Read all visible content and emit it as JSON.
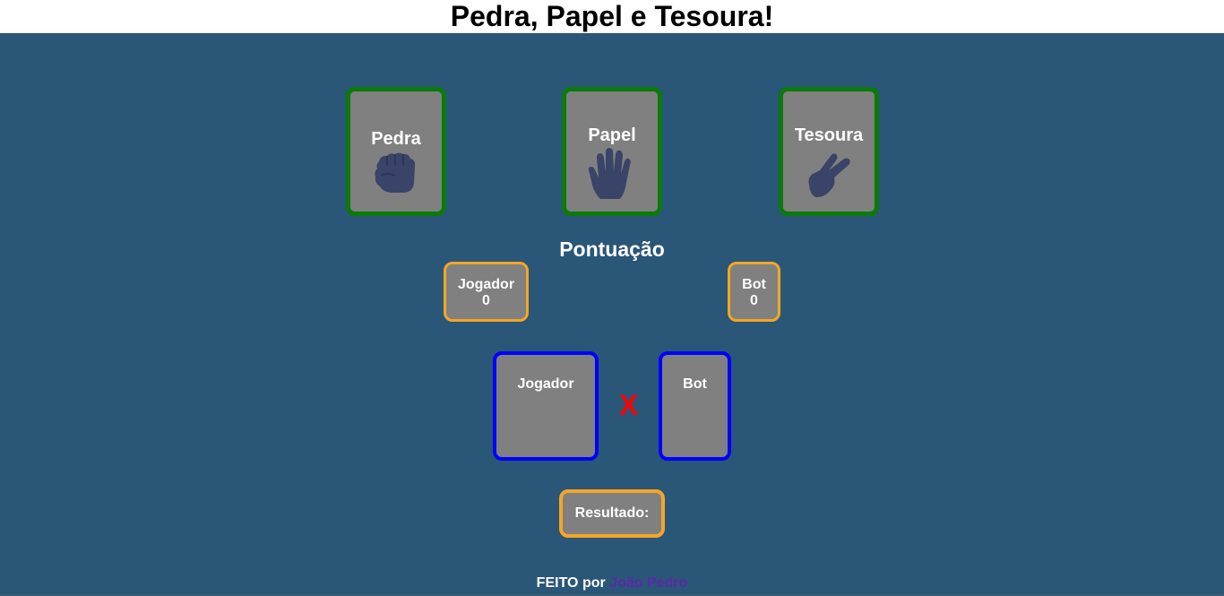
{
  "header": {
    "title": "Pedra, Papel e Tesoura!"
  },
  "choices": [
    {
      "label": "Pedra",
      "icon": "fist-icon"
    },
    {
      "label": "Papel",
      "icon": "open-hand-icon"
    },
    {
      "label": "Tesoura",
      "icon": "scissors-hand-icon"
    }
  ],
  "score": {
    "title": "Pontuação",
    "player_label": "Jogador",
    "player_value": "0",
    "bot_label": "Bot",
    "bot_value": "0"
  },
  "match": {
    "player_label": "Jogador",
    "versus": "X",
    "bot_label": "Bot"
  },
  "result": {
    "label": "Resultado:"
  },
  "footer": {
    "prefix": "FEITO por",
    "author": "João Pedro"
  },
  "colors": {
    "background": "#2a5677",
    "card": "#808080",
    "choice_border": "#0b7a0b",
    "score_border": "#f5a623",
    "slot_border": "#0000ff",
    "versus": "#ff0000",
    "icon": "#3a4468",
    "author_link": "#5b2aa8"
  }
}
